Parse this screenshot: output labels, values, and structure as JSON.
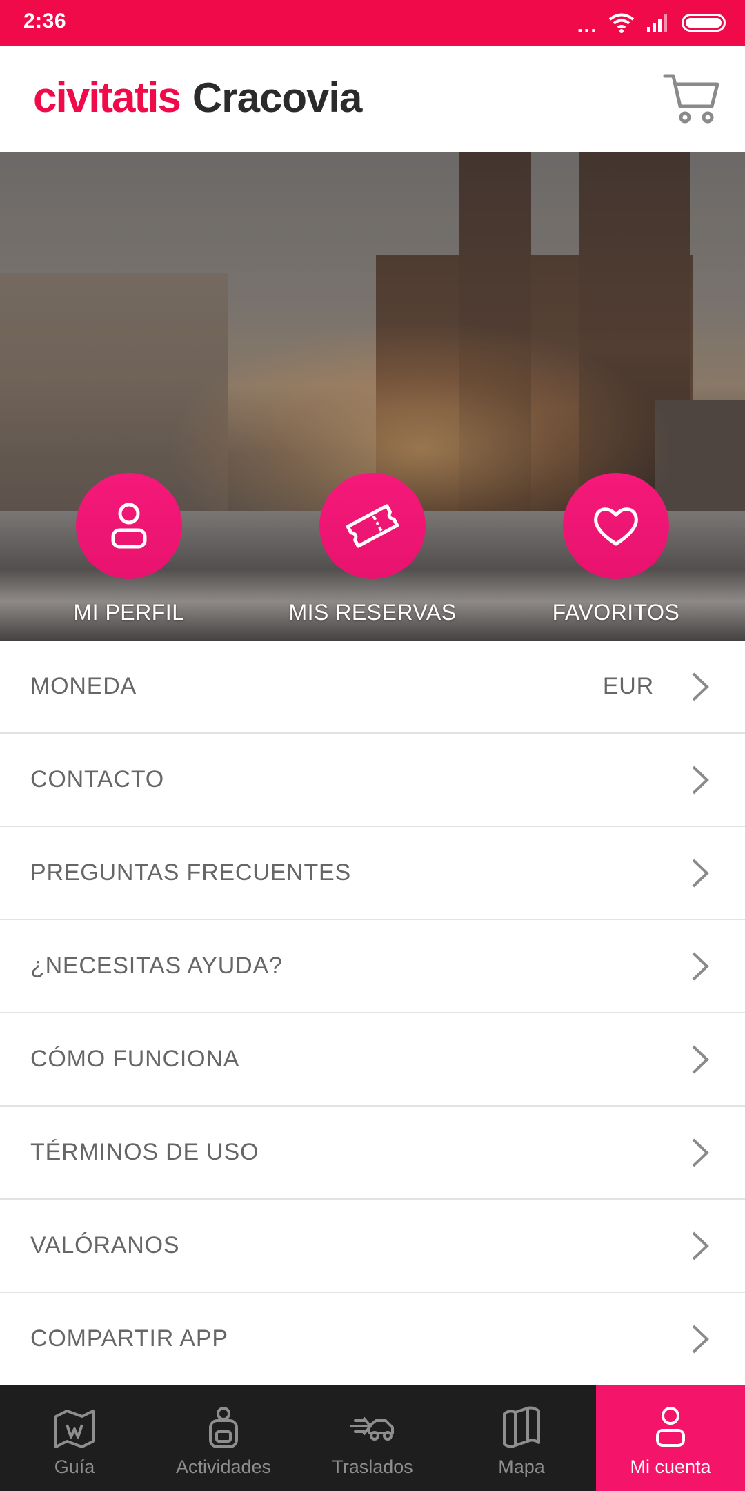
{
  "status_bar": {
    "time": "2:36",
    "dots": "..."
  },
  "header": {
    "brand": "civitatis",
    "city": "Cracovia"
  },
  "hero_actions": [
    {
      "label": "MI PERFIL",
      "icon": "user-icon"
    },
    {
      "label": "MIS RESERVAS",
      "icon": "ticket-icon"
    },
    {
      "label": "FAVORITOS",
      "icon": "heart-icon"
    }
  ],
  "menu": [
    {
      "label": "MONEDA",
      "value": "EUR"
    },
    {
      "label": "CONTACTO"
    },
    {
      "label": "PREGUNTAS FRECUENTES"
    },
    {
      "label": "¿NECESITAS AYUDA?"
    },
    {
      "label": "CÓMO FUNCIONA"
    },
    {
      "label": "TÉRMINOS DE USO"
    },
    {
      "label": "VALÓRANOS"
    },
    {
      "label": "COMPARTIR APP"
    }
  ],
  "bottom_nav": [
    {
      "label": "Guía",
      "icon": "map-pin-icon"
    },
    {
      "label": "Actividades",
      "icon": "backpack-icon"
    },
    {
      "label": "Traslados",
      "icon": "car-icon"
    },
    {
      "label": "Mapa",
      "icon": "map-icon"
    },
    {
      "label": "Mi cuenta",
      "icon": "user-icon",
      "active": true
    }
  ],
  "colors": {
    "brand": "#f10a4a",
    "accent": "#f4156a",
    "nav_bg": "#1e1e1e",
    "text": "#666666"
  }
}
